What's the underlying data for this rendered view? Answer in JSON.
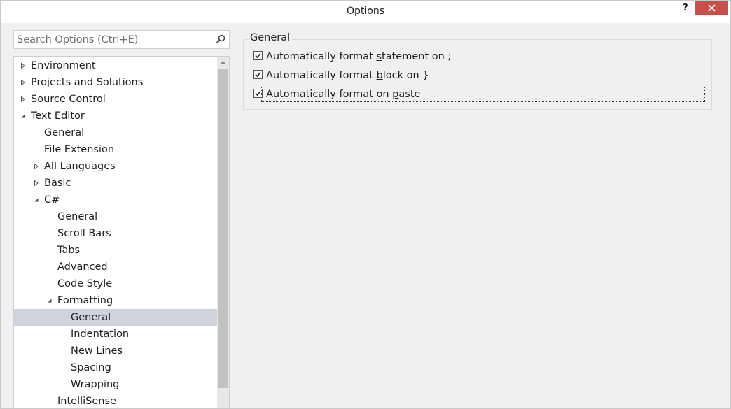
{
  "window": {
    "title": "Options",
    "help_label": "?"
  },
  "search": {
    "placeholder": "Search Options (Ctrl+E)"
  },
  "tree": {
    "items": [
      {
        "label": "Environment",
        "state": "collapsed"
      },
      {
        "label": "Projects and Solutions",
        "state": "collapsed"
      },
      {
        "label": "Source Control",
        "state": "collapsed"
      },
      {
        "label": "Text Editor",
        "state": "expanded"
      },
      {
        "label": "General",
        "state": "leaf"
      },
      {
        "label": "File Extension",
        "state": "leaf"
      },
      {
        "label": "All Languages",
        "state": "collapsed"
      },
      {
        "label": "Basic",
        "state": "collapsed"
      },
      {
        "label": "C#",
        "state": "expanded"
      },
      {
        "label": "General",
        "state": "leaf"
      },
      {
        "label": "Scroll Bars",
        "state": "leaf"
      },
      {
        "label": "Tabs",
        "state": "leaf"
      },
      {
        "label": "Advanced",
        "state": "leaf"
      },
      {
        "label": "Code Style",
        "state": "leaf"
      },
      {
        "label": "Formatting",
        "state": "expanded"
      },
      {
        "label": "General",
        "state": "leaf",
        "selected": true
      },
      {
        "label": "Indentation",
        "state": "leaf"
      },
      {
        "label": "New Lines",
        "state": "leaf"
      },
      {
        "label": "Spacing",
        "state": "leaf"
      },
      {
        "label": "Wrapping",
        "state": "leaf"
      },
      {
        "label": "IntelliSense",
        "state": "leaf"
      }
    ]
  },
  "group": {
    "title": "General",
    "options": [
      {
        "pre": "Automatically format ",
        "accel": "s",
        "post": "tatement on ;",
        "checked": true
      },
      {
        "pre": "Automatically format ",
        "accel": "b",
        "post": "lock on }",
        "checked": true
      },
      {
        "pre": "Automatically format on ",
        "accel": "p",
        "post": "aste",
        "checked": true,
        "focused": true
      }
    ]
  },
  "colors": {
    "close_button": "#c7504b",
    "selection": "#cfd3df"
  }
}
